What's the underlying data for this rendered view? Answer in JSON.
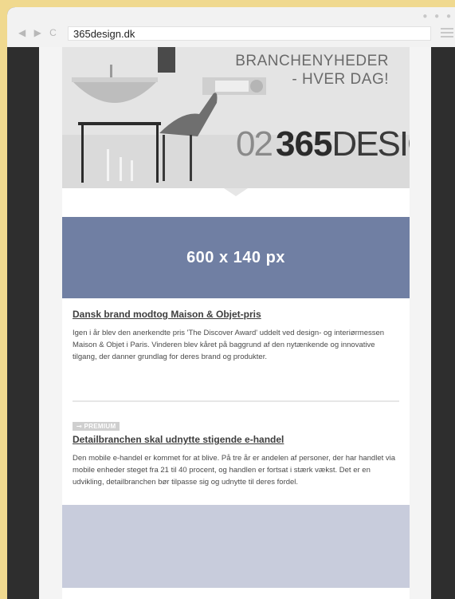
{
  "browser": {
    "url": "365design.dk",
    "nav_back": "◀",
    "nav_forward": "▶",
    "nav_refresh": "C",
    "dots": "● ● ●"
  },
  "hero": {
    "tagline_line1": "BRANCHENYHEDER",
    "tagline_line2": "- HVER DAG!",
    "brand_number": "02",
    "brand_name_bold": "365",
    "brand_name_light": "DESIGN"
  },
  "banner": {
    "label": "600 x 140 px"
  },
  "articles": [
    {
      "title": "Dansk brand modtog Maison & Objet-pris",
      "body": "Igen i år blev den anerkendte pris 'The Discover Award' uddelt ved design- og interiørmessen Maison & Objet i Paris. Vinderen blev kåret på baggrund af den nytænkende og innovative tilgang, der danner grundlag for deres brand og produkter."
    },
    {
      "badge": "⊸ PREMIUM",
      "title": "Detailbranchen skal udnytte stigende e-handel",
      "body": "Den mobile e-handel er kommet for at blive. På tre år er andelen af personer, der har handlet via mobile enheder steget fra 21 til 40 procent, og handlen er fortsat i stærk vækst. Det er en udvikling, detailbranchen bør tilpasse sig og udnytte til deres fordel."
    }
  ]
}
